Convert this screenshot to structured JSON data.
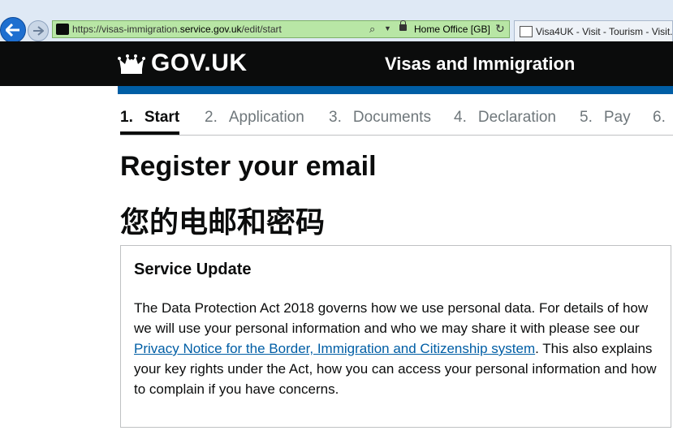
{
  "browser": {
    "url_prefix": "https://visas-immigration.",
    "url_domain": "service.gov.uk",
    "url_path": "/edit/start",
    "certificate": "Home Office [GB]",
    "tab_title": "Visa4UK - Visit - Tourism - Visit..."
  },
  "header": {
    "logo": "GOV.UK",
    "service_name": "Visas and Immigration"
  },
  "steps": [
    {
      "num": "1.",
      "label": "Start",
      "active": true
    },
    {
      "num": "2.",
      "label": "Application"
    },
    {
      "num": "3.",
      "label": "Documents"
    },
    {
      "num": "4.",
      "label": "Declaration"
    },
    {
      "num": "5.",
      "label": "Pay"
    },
    {
      "num": "6.",
      "label": ""
    }
  ],
  "main": {
    "title_en": "Register your email",
    "title_zh": "您的电邮和密码"
  },
  "panel": {
    "title": "Service Update",
    "text_before": "The Data Protection Act 2018 governs how we use personal data. For details of how we will use your personal information and who we may share it with please see our ",
    "link_text": "Privacy Notice for the Border, Immigration and Citizenship system",
    "text_after": ". This also explains your key rights under the Act, how you can access your personal information and how to complain if you have concerns."
  },
  "colors": {
    "header_bg": "#0b0c0c",
    "accent_blue": "#005ea5",
    "address_bar": "#b8e6a5"
  }
}
